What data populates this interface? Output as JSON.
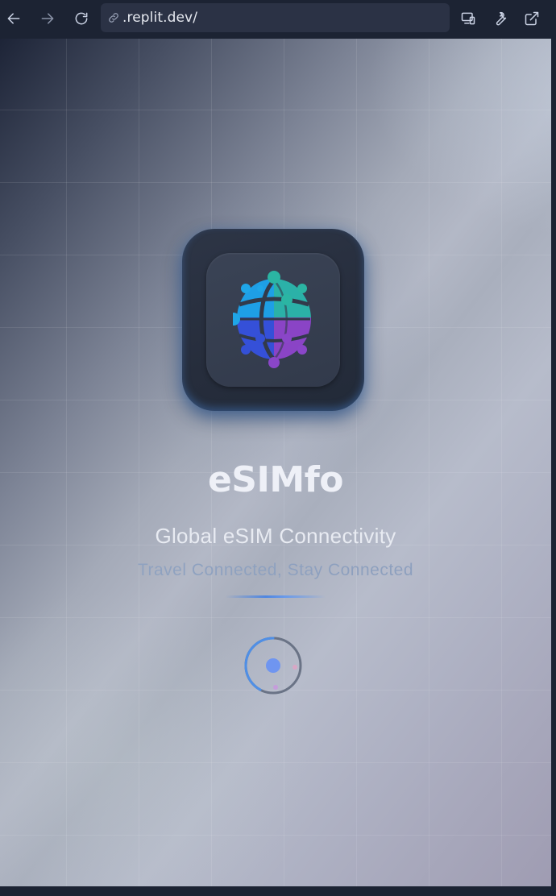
{
  "browser": {
    "url": ".replit.dev/",
    "icons": {
      "back": "arrow-left-icon",
      "forward": "arrow-right-icon",
      "reload": "reload-icon",
      "link": "link-icon",
      "devices": "devices-icon",
      "tools": "wrench-icon",
      "external": "external-link-icon"
    }
  },
  "app": {
    "title": "eSIMfo",
    "subtitle": "Global eSIM Connectivity",
    "tagline": "Travel Connected, Stay Connected",
    "logo_icon": "globe-network-icon",
    "loading_icon": "loading-spinner-icon"
  },
  "colors": {
    "browser_chrome": "#1c2333",
    "url_bar": "#2b3245",
    "accent_blue": "#4f86e0",
    "globe_cyan": "#1fa6e8",
    "globe_teal": "#2bb5a3",
    "globe_indigo": "#3450d6",
    "globe_purple": "#8a46c8"
  }
}
